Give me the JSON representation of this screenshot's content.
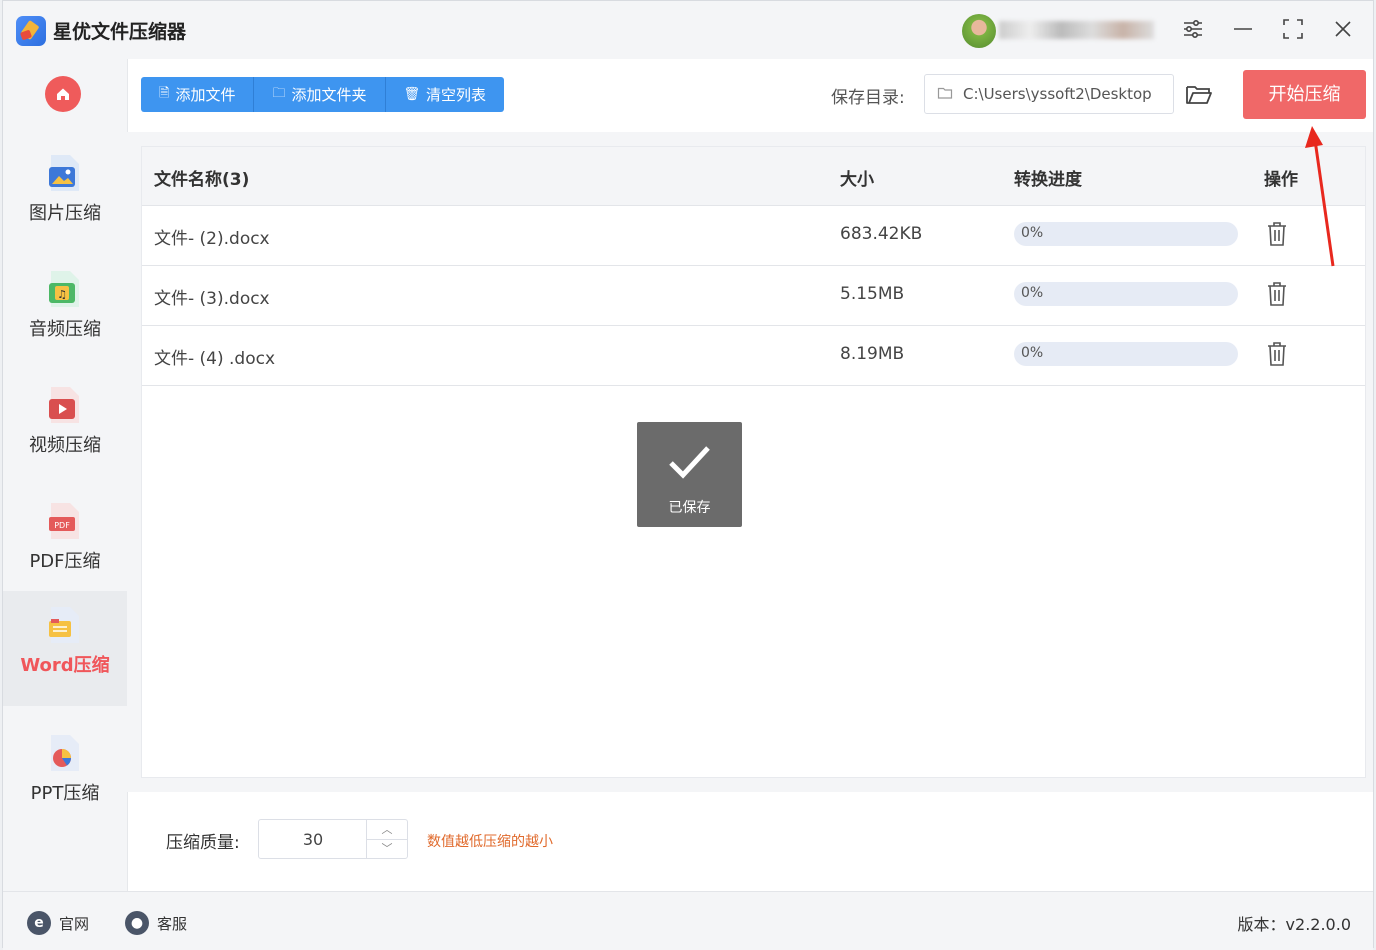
{
  "app": {
    "title": "星优文件压缩器"
  },
  "sidebar": {
    "items": [
      {
        "label": "图片压缩",
        "icon": "image-file-icon"
      },
      {
        "label": "音频压缩",
        "icon": "audio-file-icon"
      },
      {
        "label": "视频压缩",
        "icon": "video-file-icon"
      },
      {
        "label": "PDF压缩",
        "icon": "pdf-file-icon"
      },
      {
        "label": "Word压缩",
        "icon": "word-file-icon",
        "active": true
      },
      {
        "label": "PPT压缩",
        "icon": "ppt-file-icon"
      }
    ]
  },
  "toolbar": {
    "add_file": "添加文件",
    "add_folder": "添加文件夹",
    "clear_list": "清空列表",
    "save_dir_label": "保存目录:",
    "save_dir_value": "C:\\Users\\yssoft2\\Desktop",
    "start": "开始压缩"
  },
  "table": {
    "headers": {
      "name": "文件名称(3)",
      "size": "大小",
      "progress": "转换进度",
      "action": "操作"
    },
    "rows": [
      {
        "name": "文件- (2).docx",
        "size": "683.42KB",
        "progress_text": "0%",
        "progress": 0
      },
      {
        "name": "文件- (3).docx",
        "size": "5.15MB",
        "progress_text": "0%",
        "progress": 0
      },
      {
        "name": "文件- (4) .docx",
        "size": "8.19MB",
        "progress_text": "0%",
        "progress": 0
      }
    ]
  },
  "toast": {
    "label": "已保存"
  },
  "quality": {
    "label": "压缩质量:",
    "value": "30",
    "hint": "数值越低压缩的越小"
  },
  "footer": {
    "website": "官网",
    "support": "客服",
    "version": "版本：v2.2.0.0"
  },
  "colors": {
    "accent_blue": "#3e95f0",
    "accent_red": "#f06868",
    "active_text": "#f0565a",
    "hint": "#e06a2c"
  }
}
